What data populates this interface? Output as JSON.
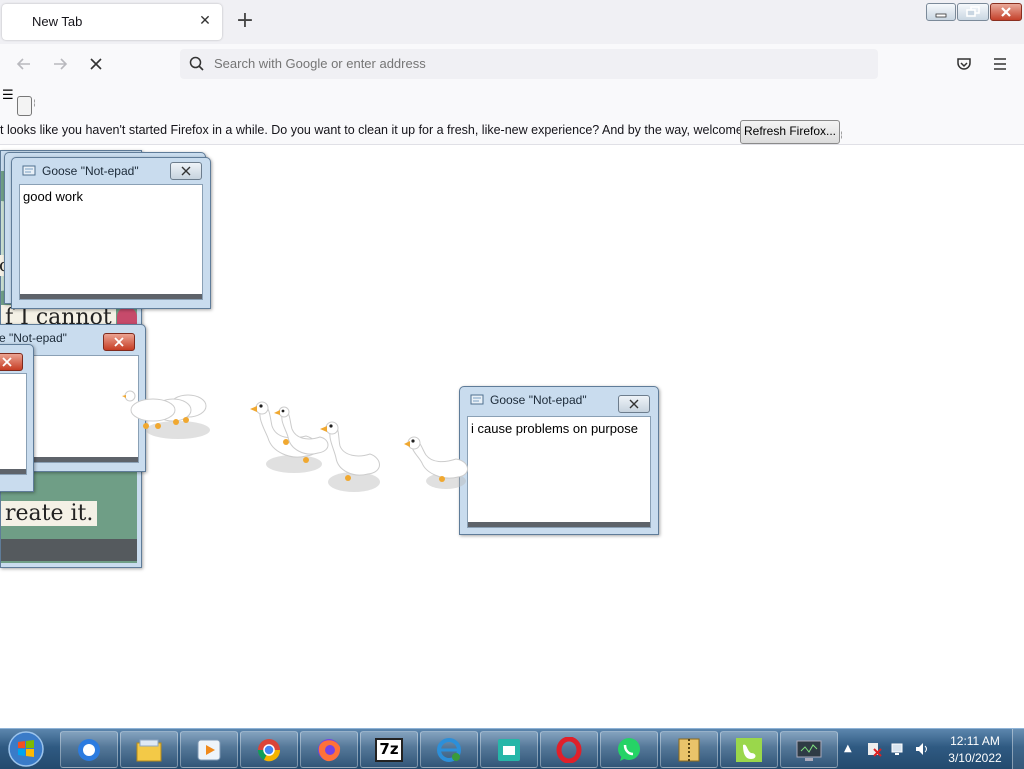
{
  "browser": {
    "tab_title": "New Tab",
    "address_placeholder": "Search with Google or enter address",
    "notice": "t looks like you haven't started Firefox in a while. Do you want to clean it up for a fresh, like-new experience? And by the way, welcome back!",
    "refresh_button": "Refresh Firefox..."
  },
  "windows": {
    "top_left": {
      "title": "Goose \"Not-epad\"",
      "text": "good work"
    },
    "middle_left": {
      "title": "e \"Not-epad\"",
      "text": ""
    },
    "front_left": {
      "title": "",
      "text": ""
    },
    "center": {
      "title": "Goose \"Not-epad\"",
      "text": "i cause problems on purpose"
    }
  },
  "background_art": {
    "text_top": "f I cannot",
    "text_side": "o",
    "text_bottom": "reate it."
  },
  "taskbar": {
    "apps": [
      "chrome-remote-icon",
      "file-explorer-icon",
      "media-player-icon",
      "chrome-icon",
      "firefox-icon",
      "7zip-icon",
      "internet-explorer-icon",
      "image-viewer-icon",
      "opera-icon",
      "whatsapp-icon",
      "archive-icon",
      "goose-icon",
      "desktop-goose-monitor-icon"
    ],
    "seven_zip_label": "7z",
    "time": "12:11 AM",
    "date": "3/10/2022"
  },
  "colors": {
    "taskbar": "#2f5a82",
    "window_frame": "#c9dcee",
    "close_red": "#c63d24"
  }
}
